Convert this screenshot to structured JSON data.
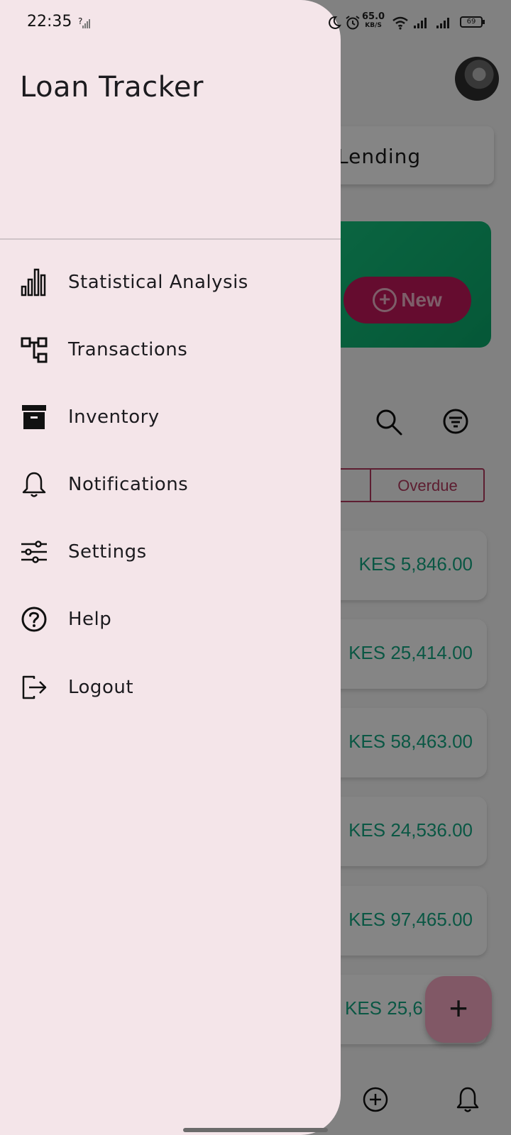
{
  "status_bar": {
    "time": "22:35",
    "network_speed": "65.0",
    "network_speed_unit": "KB/S",
    "battery": "69"
  },
  "background_app": {
    "segment_label": "Lending",
    "new_button_label": "New",
    "filter_chip_label": "Overdue",
    "amounts": [
      "KES 5,846.00",
      "KES 25,414.00",
      "KES 58,463.00",
      "KES 24,536.00",
      "KES 97,465.00",
      "KES 25,6"
    ],
    "fab_label": "+",
    "colors": {
      "accent_green": "#15a882",
      "accent_pink": "#c2185b"
    }
  },
  "drawer": {
    "title": "Loan Tracker",
    "items": [
      {
        "label": "Statistical Analysis",
        "icon": "bar-chart-icon"
      },
      {
        "label": "Transactions",
        "icon": "transactions-icon"
      },
      {
        "label": "Inventory",
        "icon": "archive-icon"
      },
      {
        "label": "Notifications",
        "icon": "bell-icon"
      },
      {
        "label": "Settings",
        "icon": "sliders-icon"
      },
      {
        "label": "Help",
        "icon": "help-icon"
      },
      {
        "label": "Logout",
        "icon": "logout-icon"
      }
    ],
    "background_color": "#f4e5e9"
  }
}
